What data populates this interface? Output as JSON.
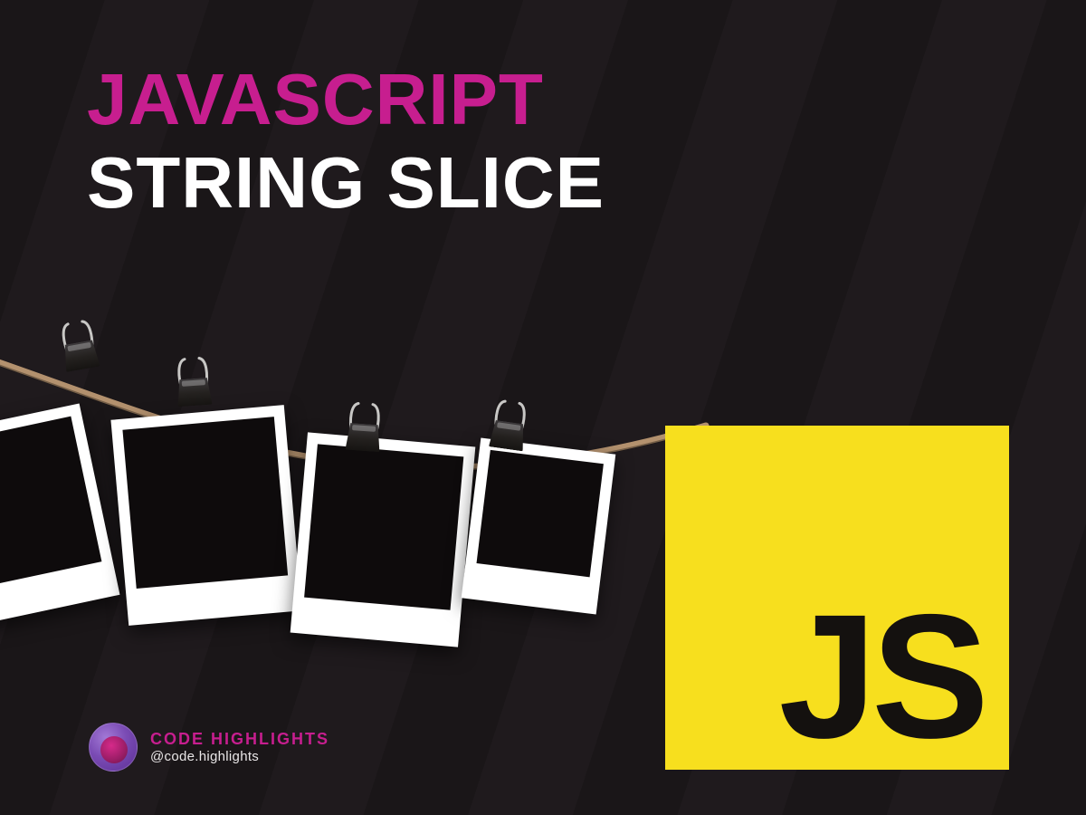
{
  "heading": {
    "line1": "JAVASCRIPT",
    "line2": "STRING SLICE"
  },
  "js_logo": {
    "label": "JS",
    "bg_color": "#f7df1e",
    "fg_color": "#14110f"
  },
  "credit": {
    "brand": "CODE HIGHLIGHTS",
    "handle": "@code.highlights"
  },
  "colors": {
    "accent_pink": "#c71e8f",
    "background": "#1a1618",
    "white": "#ffffff"
  }
}
